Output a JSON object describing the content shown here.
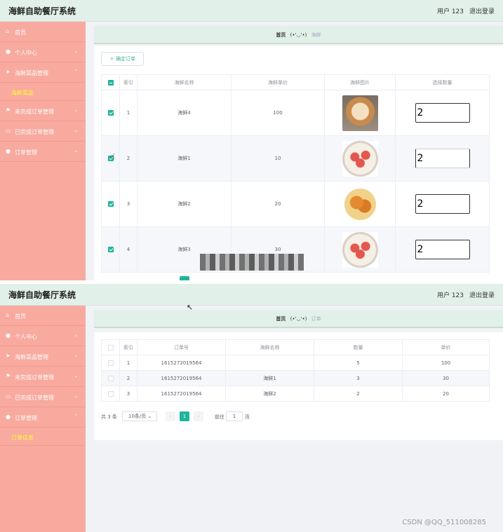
{
  "app": {
    "title": "海鲜自助餐厅系统",
    "user_label": "用户 123",
    "logout_label": "退出登录"
  },
  "colors": {
    "sidebar_bg": "#f8aa9f",
    "header_bg": "#e2f0ea",
    "accent": "#1fb59b",
    "active_submenu_text": "#ffff2e"
  },
  "screen1": {
    "menu": [
      {
        "icon": "home-icon",
        "label": "首页",
        "expanded": false
      },
      {
        "icon": "user-icon",
        "label": "个人中心",
        "expanded": false
      },
      {
        "icon": "send-icon",
        "label": "海鲜菜品管理",
        "expanded": true
      },
      {
        "icon": "flag-icon",
        "label": "未完成订单管理",
        "expanded": false
      },
      {
        "icon": "card-icon",
        "label": "已完成订单管理",
        "expanded": false
      },
      {
        "icon": "user-icon",
        "label": "订单管理",
        "expanded": false
      }
    ],
    "submenu_label": "海鲜菜品",
    "breadcrumb": {
      "home": "首页",
      "face": "(•'◡'•)",
      "current": "海鲜"
    },
    "confirm_button": "＋ 确定订单",
    "columns": [
      "",
      "索引",
      "海鲜名称",
      "海鲜单价",
      "海鲜图片",
      "选择数量"
    ],
    "rows": [
      {
        "index": "1",
        "name": "海鲜4",
        "price": "100",
        "image": "dog",
        "qty": "2",
        "checked": true
      },
      {
        "index": "2",
        "name": "海鲜1",
        "price": "10",
        "image": "plate",
        "qty": "2",
        "checked": true
      },
      {
        "index": "3",
        "name": "海鲜2",
        "price": "20",
        "image": "shrimp",
        "qty": "2",
        "checked": true
      },
      {
        "index": "4",
        "name": "海鲜3",
        "price": "30",
        "image": "plate",
        "qty": "2",
        "checked": true
      }
    ]
  },
  "screen2": {
    "menu": [
      {
        "icon": "home-icon",
        "label": "首页",
        "expanded": false
      },
      {
        "icon": "user-icon",
        "label": "个人中心",
        "expanded": false
      },
      {
        "icon": "send-icon",
        "label": "海鲜菜品管理",
        "expanded": false
      },
      {
        "icon": "flag-icon",
        "label": "未完成订单管理",
        "expanded": false
      },
      {
        "icon": "card-icon",
        "label": "已完成订单管理",
        "expanded": false
      },
      {
        "icon": "user-icon",
        "label": "订单管理",
        "expanded": true
      }
    ],
    "submenu_label": "订单信息",
    "breadcrumb": {
      "home": "首页",
      "face": "(•'◡'•)",
      "current": "订单"
    },
    "columns": [
      "",
      "索引",
      "订单号",
      "海鲜名称",
      "数量",
      "单价"
    ],
    "rows": [
      {
        "index": "1",
        "order_no": "1615272019564",
        "name": "",
        "qty": "5",
        "price": "100"
      },
      {
        "index": "2",
        "order_no": "1615272019564",
        "name": "海鲜1",
        "qty": "3",
        "price": "30"
      },
      {
        "index": "3",
        "order_no": "1615272019564",
        "name": "海鲜2",
        "qty": "2",
        "price": "20"
      }
    ],
    "pager": {
      "total": "共 3 条",
      "page_size": "10条/页",
      "current_page": "1",
      "jump_label": "前往",
      "jump_value": "1",
      "page_suffix": "页"
    }
  },
  "watermark": "CSDN @QQ_511008285"
}
